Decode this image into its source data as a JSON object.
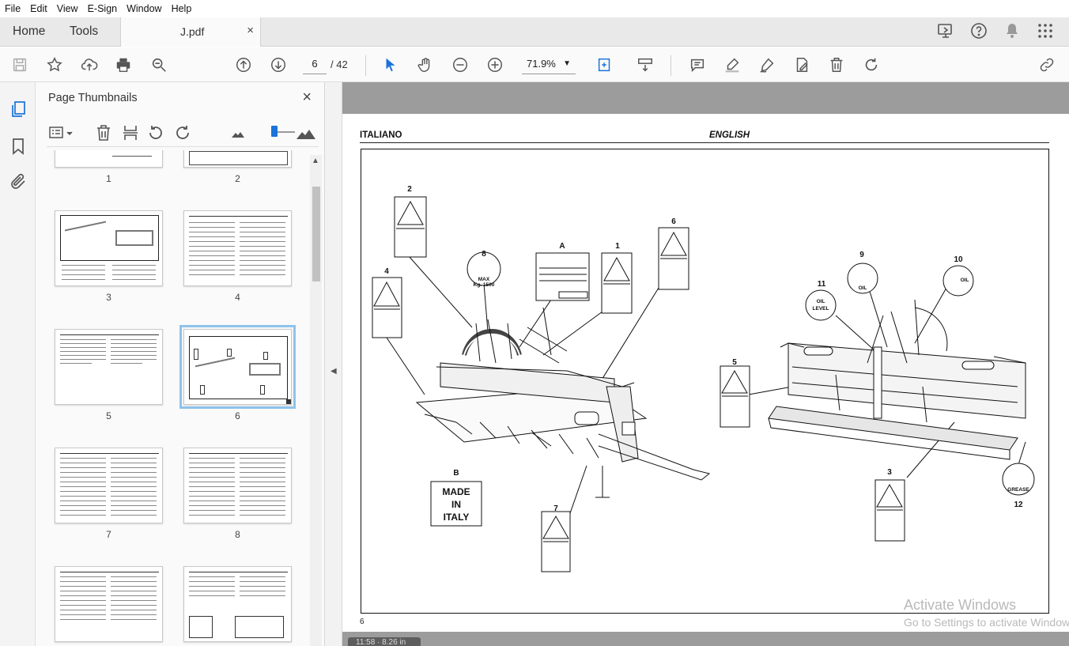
{
  "menu": [
    "File",
    "Edit",
    "View",
    "E-Sign",
    "Window",
    "Help"
  ],
  "tabs": {
    "home": "Home",
    "tools": "Tools",
    "document": "J.pdf",
    "close": "×"
  },
  "toolbar": {
    "current_page": "6",
    "total_pages": "/ 42",
    "zoom": "71.9%"
  },
  "thumbnails": {
    "title": "Page Thumbnails",
    "close": "×",
    "pages": [
      "1",
      "2",
      "3",
      "4",
      "5",
      "6",
      "7",
      "8"
    ],
    "selected": "6"
  },
  "document": {
    "header_left": "ITALIANO",
    "header_right": "ENGLISH",
    "page_number": "6",
    "callouts": {
      "n1": "1",
      "n2": "2",
      "n3": "3",
      "n4": "4",
      "n5": "5",
      "n6": "6",
      "n7": "7",
      "n8": "8",
      "n9": "9",
      "n10": "10",
      "n11": "11",
      "n12": "12",
      "a": "A",
      "b": "B"
    },
    "made_in_italy": [
      "MADE",
      "IN",
      "ITALY"
    ],
    "hook_label_1": "MAX",
    "hook_label_2": "Kg. 1500",
    "oil_level_1": "OIL",
    "oil_level_2": "LEVEL",
    "oil_9": "OIL",
    "oil_10": "OIL",
    "grease": "GREASE"
  },
  "status": {
    "time": "11:58 · 8.26 in"
  },
  "watermark": {
    "line1": "Activate Windows",
    "line2": "Go to Settings to activate Windows."
  },
  "colors": {
    "accent": "#1a73d9",
    "selected_outline": "#8ec3ea",
    "doc_background": "#9c9c9c"
  }
}
